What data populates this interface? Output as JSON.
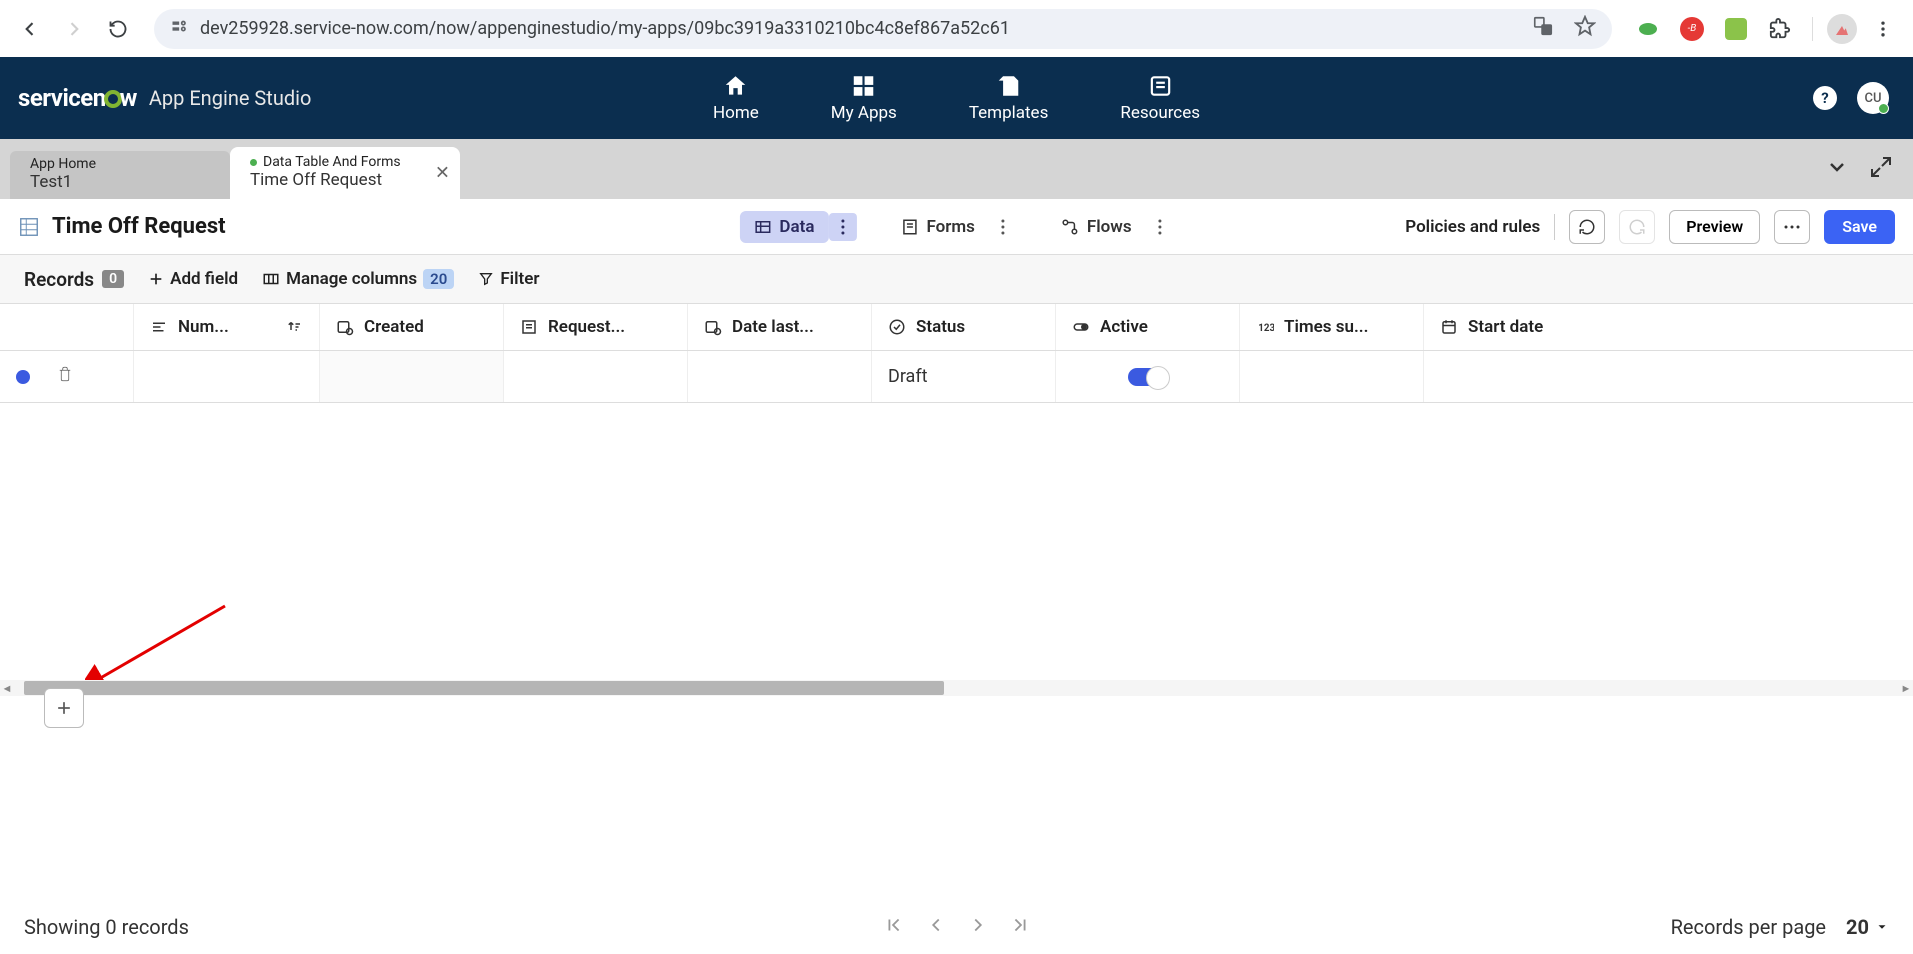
{
  "browser": {
    "url": "dev259928.service-now.com/now/appenginestudio/my-apps/09bc3919a3310210bc4c8ef867a52c61"
  },
  "header": {
    "logo_prefix": "service",
    "logo_o": "n",
    "logo_suffix": "w",
    "product": "App Engine Studio",
    "nav": {
      "home": "Home",
      "my_apps": "My Apps",
      "templates": "Templates",
      "resources": "Resources"
    },
    "user_initials": "CU"
  },
  "tabs": {
    "app_home_type": "App Home",
    "app_home_title": "Test1",
    "active_type": "Data Table And Forms",
    "active_title": "Time Off Request"
  },
  "titlebar": {
    "page_title": "Time Off Request",
    "data": "Data",
    "forms": "Forms",
    "flows": "Flows",
    "policies": "Policies and rules",
    "preview": "Preview",
    "save": "Save"
  },
  "records": {
    "label": "Records",
    "count": "0",
    "add_field": "Add field",
    "manage_columns": "Manage columns",
    "columns_count": "20",
    "filter": "Filter"
  },
  "columns": {
    "number": "Num...",
    "created": "Created",
    "requested": "Request...",
    "date_last": "Date last...",
    "status": "Status",
    "active": "Active",
    "times_su": "Times su...",
    "start_date": "Start date"
  },
  "row": {
    "status": "Draft"
  },
  "footer": {
    "showing": "Showing 0 records",
    "per_page_label": "Records per page",
    "per_page_value": "20"
  }
}
